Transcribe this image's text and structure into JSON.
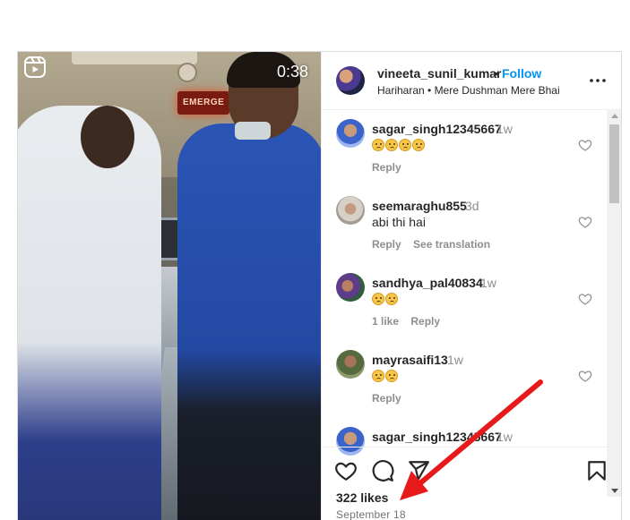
{
  "post": {
    "duration": "0:38",
    "media_sign_text": "EMERGE",
    "header": {
      "username": "vineeta_sunil_kumar",
      "separator": "•",
      "follow_label": "Follow",
      "audio": "Hariharan • Mere Dushman Mere Bhai",
      "more_icon": "more-horizontal-icon"
    },
    "comments": [
      {
        "username": "sagar_singh12345667",
        "time": "1w",
        "text": "",
        "emoji_count": 4,
        "actions": [
          "Reply"
        ]
      },
      {
        "username": "seemaraghu855",
        "time": "3d",
        "text": "abi thi hai",
        "emoji_count": 0,
        "actions": [
          "Reply",
          "See translation"
        ]
      },
      {
        "username": "sandhya_pal40834",
        "time": "1w",
        "text": "",
        "emoji_count": 2,
        "actions": [
          "1 like",
          "Reply"
        ]
      },
      {
        "username": "mayrasaifi13",
        "time": "1w",
        "text": "",
        "emoji_count": 2,
        "actions": [
          "Reply"
        ]
      },
      {
        "username": "sagar_singh12345667",
        "time": "1w",
        "text": "",
        "emoji_count": 0,
        "actions": []
      }
    ],
    "likes": "322 likes",
    "date": "September 18",
    "icons": [
      "like-heart-icon",
      "comment-icon",
      "share-icon",
      "bookmark-icon"
    ],
    "colors": {
      "follow": "#0095f6",
      "arrow": "#e8191a",
      "text": "#262626",
      "muted": "#8e8e8e"
    }
  }
}
